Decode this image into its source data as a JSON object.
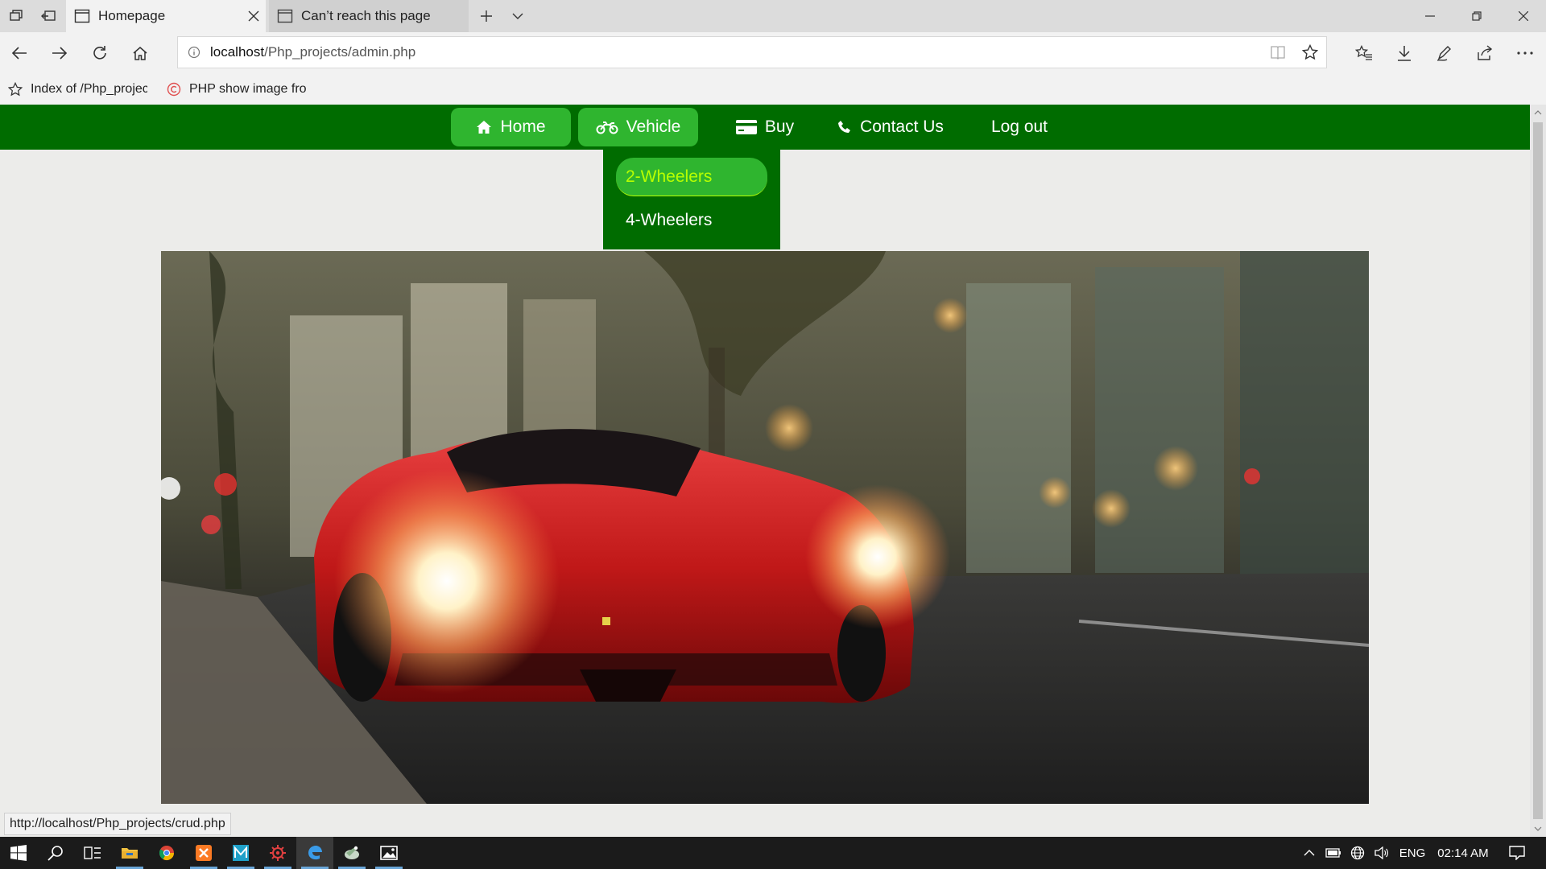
{
  "browser": {
    "tabs": [
      {
        "label": "Homepage",
        "active": true
      },
      {
        "label": "Can’t reach this page",
        "active": false
      }
    ],
    "address": {
      "host": "localhost",
      "path": "/Php_projects/admin.php"
    },
    "favorites": [
      {
        "label": "Index of /Php_projec",
        "icon": "star-icon"
      },
      {
        "label": "PHP show image fro",
        "icon": "copyright-site-icon"
      }
    ],
    "status_url": "http://localhost/Php_projects/crud.php"
  },
  "site": {
    "menu": [
      {
        "label": "Home",
        "icon": "home-icon"
      },
      {
        "label": "Vehicle",
        "icon": "motorcycle-icon"
      },
      {
        "label": "Buy",
        "icon": "credit-card-icon"
      },
      {
        "label": "Contact Us",
        "icon": "phone-icon"
      },
      {
        "label": "Log out"
      }
    ],
    "vehicle_submenu": [
      {
        "label": "2-Wheelers",
        "active": true
      },
      {
        "label": "4-Wheelers",
        "active": false
      }
    ],
    "hero": {
      "subject": "red sports car on city street at dusk"
    }
  },
  "taskbar": {
    "apps": [
      "file-explorer-icon",
      "chrome-icon",
      "xampp-icon",
      "mysql-workbench-icon",
      "settings-gear-icon",
      "edge-icon",
      "app-icon",
      "photos-icon"
    ],
    "language": "ENG",
    "time": "02:14 AM"
  },
  "colors": {
    "menubar": "#006c00",
    "menu_pill": "#2fb52f",
    "dropdown_active_text": "#b8ff00"
  }
}
